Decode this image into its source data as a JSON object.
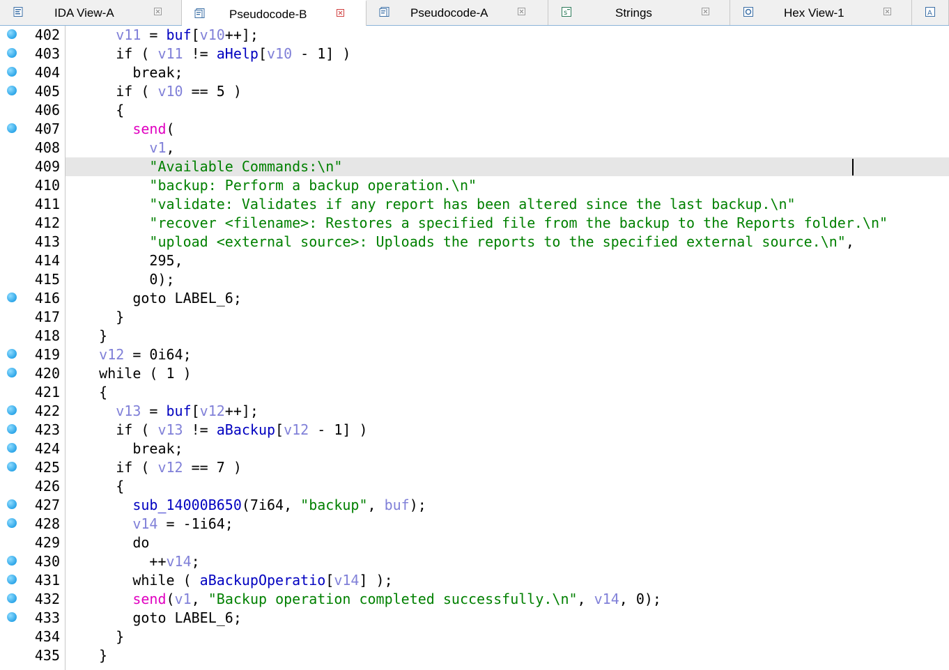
{
  "tabs": [
    {
      "label": "IDA View-A",
      "icon": "ida-view-icon",
      "active": false
    },
    {
      "label": "Pseudocode-B",
      "icon": "pseudocode-icon",
      "active": true
    },
    {
      "label": "Pseudocode-A",
      "icon": "pseudocode-icon",
      "active": false
    },
    {
      "label": "Strings",
      "icon": "strings-icon",
      "active": false
    },
    {
      "label": "Hex View-1",
      "icon": "hex-view-icon",
      "active": false
    },
    {
      "label": "",
      "icon": "structures-icon",
      "active": false
    }
  ],
  "colors": {
    "keyword": "#000000",
    "variable": "#8080d8",
    "global": "#0000c0",
    "string": "#008000",
    "import": "#e000c0",
    "number": "#000000",
    "breakpoint_dot": "#2ea6e8",
    "highlight_line": "#e6e6e6"
  },
  "lines": [
    {
      "num": "402",
      "dot": true,
      "tokens": [
        [
          "p",
          "      "
        ],
        [
          "v",
          "v11"
        ],
        [
          "p",
          " = "
        ],
        [
          "g",
          "buf"
        ],
        [
          "p",
          "["
        ],
        [
          "v",
          "v10"
        ],
        [
          "p",
          "++];"
        ]
      ]
    },
    {
      "num": "403",
      "dot": true,
      "tokens": [
        [
          "p",
          "      if ( "
        ],
        [
          "v",
          "v11"
        ],
        [
          "p",
          " != "
        ],
        [
          "g",
          "aHelp"
        ],
        [
          "p",
          "["
        ],
        [
          "v",
          "v10"
        ],
        [
          "p",
          " - 1] )"
        ]
      ]
    },
    {
      "num": "404",
      "dot": true,
      "tokens": [
        [
          "p",
          "        break;"
        ]
      ]
    },
    {
      "num": "405",
      "dot": true,
      "tokens": [
        [
          "p",
          "      if ( "
        ],
        [
          "v",
          "v10"
        ],
        [
          "p",
          " == 5 )"
        ]
      ]
    },
    {
      "num": "406",
      "dot": false,
      "tokens": [
        [
          "p",
          "      {"
        ]
      ]
    },
    {
      "num": "407",
      "dot": true,
      "tokens": [
        [
          "p",
          "        "
        ],
        [
          "i",
          "send"
        ],
        [
          "p",
          "("
        ]
      ]
    },
    {
      "num": "408",
      "dot": false,
      "tokens": [
        [
          "p",
          "          "
        ],
        [
          "v",
          "v1"
        ],
        [
          "p",
          ","
        ]
      ]
    },
    {
      "num": "409",
      "dot": false,
      "highlight": true,
      "tokens": [
        [
          "p",
          "          "
        ],
        [
          "s",
          "\"Available Commands:\\n\""
        ]
      ]
    },
    {
      "num": "410",
      "dot": false,
      "tokens": [
        [
          "p",
          "          "
        ],
        [
          "s",
          "\"backup: Perform a backup operation.\\n\""
        ]
      ]
    },
    {
      "num": "411",
      "dot": false,
      "tokens": [
        [
          "p",
          "          "
        ],
        [
          "s",
          "\"validate: Validates if any report has been altered since the last backup.\\n\""
        ]
      ]
    },
    {
      "num": "412",
      "dot": false,
      "tokens": [
        [
          "p",
          "          "
        ],
        [
          "s",
          "\"recover <filename>: Restores a specified file from the backup to the Reports folder.\\n\""
        ]
      ]
    },
    {
      "num": "413",
      "dot": false,
      "tokens": [
        [
          "p",
          "          "
        ],
        [
          "s",
          "\"upload <external source>: Uploads the reports to the specified external source.\\n\""
        ],
        [
          "p",
          ","
        ]
      ]
    },
    {
      "num": "414",
      "dot": false,
      "tokens": [
        [
          "p",
          "          295,"
        ]
      ]
    },
    {
      "num": "415",
      "dot": false,
      "tokens": [
        [
          "p",
          "          0);"
        ]
      ]
    },
    {
      "num": "416",
      "dot": true,
      "tokens": [
        [
          "p",
          "        goto LABEL_6;"
        ]
      ]
    },
    {
      "num": "417",
      "dot": false,
      "tokens": [
        [
          "p",
          "      }"
        ]
      ]
    },
    {
      "num": "418",
      "dot": false,
      "tokens": [
        [
          "p",
          "    }"
        ]
      ]
    },
    {
      "num": "419",
      "dot": true,
      "tokens": [
        [
          "p",
          "    "
        ],
        [
          "v",
          "v12"
        ],
        [
          "p",
          " = 0i64;"
        ]
      ]
    },
    {
      "num": "420",
      "dot": true,
      "tokens": [
        [
          "p",
          "    while ( 1 )"
        ]
      ]
    },
    {
      "num": "421",
      "dot": false,
      "tokens": [
        [
          "p",
          "    {"
        ]
      ]
    },
    {
      "num": "422",
      "dot": true,
      "tokens": [
        [
          "p",
          "      "
        ],
        [
          "v",
          "v13"
        ],
        [
          "p",
          " = "
        ],
        [
          "g",
          "buf"
        ],
        [
          "p",
          "["
        ],
        [
          "v",
          "v12"
        ],
        [
          "p",
          "++];"
        ]
      ]
    },
    {
      "num": "423",
      "dot": true,
      "tokens": [
        [
          "p",
          "      if ( "
        ],
        [
          "v",
          "v13"
        ],
        [
          "p",
          " != "
        ],
        [
          "g",
          "aBackup"
        ],
        [
          "p",
          "["
        ],
        [
          "v",
          "v12"
        ],
        [
          "p",
          " - 1] )"
        ]
      ]
    },
    {
      "num": "424",
      "dot": true,
      "tokens": [
        [
          "p",
          "        break;"
        ]
      ]
    },
    {
      "num": "425",
      "dot": true,
      "tokens": [
        [
          "p",
          "      if ( "
        ],
        [
          "v",
          "v12"
        ],
        [
          "p",
          " == 7 )"
        ]
      ]
    },
    {
      "num": "426",
      "dot": false,
      "tokens": [
        [
          "p",
          "      {"
        ]
      ]
    },
    {
      "num": "427",
      "dot": true,
      "tokens": [
        [
          "p",
          "        "
        ],
        [
          "g",
          "sub_14000B650"
        ],
        [
          "p",
          "(7i64, "
        ],
        [
          "s",
          "\"backup\""
        ],
        [
          "p",
          ", "
        ],
        [
          "v",
          "buf"
        ],
        [
          "p",
          ");"
        ]
      ]
    },
    {
      "num": "428",
      "dot": true,
      "tokens": [
        [
          "p",
          "        "
        ],
        [
          "v",
          "v14"
        ],
        [
          "p",
          " = -1i64;"
        ]
      ]
    },
    {
      "num": "429",
      "dot": false,
      "tokens": [
        [
          "p",
          "        do"
        ]
      ]
    },
    {
      "num": "430",
      "dot": true,
      "tokens": [
        [
          "p",
          "          ++"
        ],
        [
          "v",
          "v14"
        ],
        [
          "p",
          ";"
        ]
      ]
    },
    {
      "num": "431",
      "dot": true,
      "tokens": [
        [
          "p",
          "        while ( "
        ],
        [
          "g",
          "aBackupOperatio"
        ],
        [
          "p",
          "["
        ],
        [
          "v",
          "v14"
        ],
        [
          "p",
          "] );"
        ]
      ]
    },
    {
      "num": "432",
      "dot": true,
      "tokens": [
        [
          "p",
          "        "
        ],
        [
          "i",
          "send"
        ],
        [
          "p",
          "("
        ],
        [
          "v",
          "v1"
        ],
        [
          "p",
          ", "
        ],
        [
          "s",
          "\"Backup operation completed successfully.\\n\""
        ],
        [
          "p",
          ", "
        ],
        [
          "v",
          "v14"
        ],
        [
          "p",
          ", 0);"
        ]
      ]
    },
    {
      "num": "433",
      "dot": true,
      "tokens": [
        [
          "p",
          "        goto LABEL_6;"
        ]
      ]
    },
    {
      "num": "434",
      "dot": false,
      "tokens": [
        [
          "p",
          "      }"
        ]
      ]
    },
    {
      "num": "435",
      "dot": false,
      "tokens": [
        [
          "p",
          "    }"
        ]
      ]
    }
  ]
}
